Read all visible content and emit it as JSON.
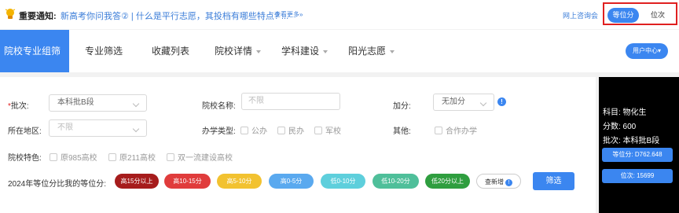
{
  "notice": {
    "label": "重要通知:",
    "text": "新高考你问我答② | 什么是平行志愿，其投档有哪些特点? ...",
    "more": "查看更多»",
    "consult": "网上咨询会",
    "toggle_rank": "等位分",
    "toggle_position": "位次"
  },
  "nav": {
    "items": [
      {
        "label": "院校专业组筛选"
      },
      {
        "label": "专业筛选"
      },
      {
        "label": "收藏列表"
      },
      {
        "label": "院校详情"
      },
      {
        "label": "学科建设"
      },
      {
        "label": "阳光志愿"
      }
    ],
    "user_center": "用户中心▾"
  },
  "form": {
    "batch_label": "批次:",
    "batch_required": "*",
    "batch_value": "本科批B段",
    "school_name_label": "院校名称:",
    "school_name_placeholder": "不限",
    "bonus_label": "加分:",
    "bonus_value": "无加分",
    "region_label": "所在地区:",
    "region_value": "不限",
    "school_type_label": "办学类型:",
    "school_types": [
      "公办",
      "民办",
      "军校"
    ],
    "other_label": "其他:",
    "other_options": [
      "合作办学"
    ],
    "feature_label": "院校特色:",
    "features": [
      "原985高校",
      "原211高校",
      "双一流建设高校"
    ],
    "rank_label": "2024年等位分比我的等位分:",
    "rank_pills": [
      {
        "label": "高15分以上",
        "color": "#a61c1c"
      },
      {
        "label": "高10-15分",
        "color": "#e03c3c"
      },
      {
        "label": "高5-10分",
        "color": "#f2c230"
      },
      {
        "label": "高0-5分",
        "color": "#5aa9ef"
      },
      {
        "label": "低0-10分",
        "color": "#5ecfdc"
      },
      {
        "label": "低10-20分",
        "color": "#4fbf9a"
      },
      {
        "label": "低20分以上",
        "color": "#2f9e3f"
      }
    ],
    "new_label": "查新增",
    "new_badge": "!",
    "filter_button": "筛选"
  },
  "card": {
    "subject": "科目: 物化生",
    "score": "分数: 600",
    "batch": "批次: 本科批B段",
    "rank_score": "等位分: D762.648",
    "position": "位次: 15699"
  }
}
